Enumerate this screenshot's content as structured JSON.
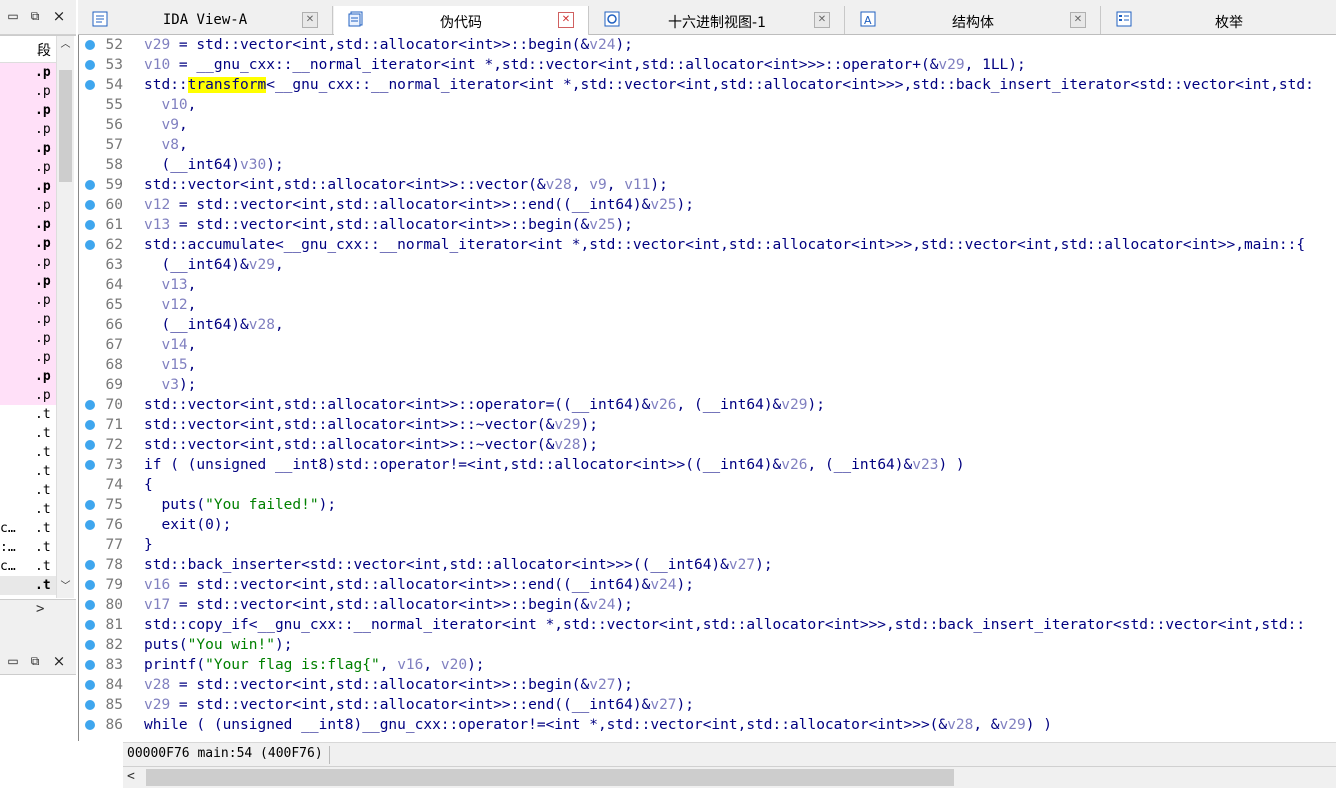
{
  "left_panel": {
    "title_buttons": [
      "×"
    ],
    "column_header": "段",
    "rows": [
      {
        "seg": ".p",
        "bold": true
      },
      {
        "seg": ".p",
        "bold": false
      },
      {
        "seg": ".p",
        "bold": true
      },
      {
        "seg": ".p",
        "bold": false
      },
      {
        "seg": ".p",
        "bold": true
      },
      {
        "seg": ".p",
        "bold": false
      },
      {
        "seg": ".p",
        "bold": true
      },
      {
        "seg": ".p",
        "bold": false
      },
      {
        "seg": ".p",
        "bold": true
      },
      {
        "seg": ".p",
        "bold": true
      },
      {
        "seg": ".p",
        "bold": false
      },
      {
        "seg": ".p",
        "bold": true
      },
      {
        "seg": ".p",
        "bold": false
      },
      {
        "seg": ".p",
        "bold": false
      },
      {
        "seg": ".p",
        "bold": false
      },
      {
        "seg": ".p",
        "bold": false
      },
      {
        "seg": ".p",
        "bold": true
      },
      {
        "seg": ".p",
        "bold": false
      },
      {
        "seg": ".t",
        "bold": false
      },
      {
        "seg": ".t",
        "bold": false
      },
      {
        "seg": ".t",
        "bold": false
      },
      {
        "seg": ".t",
        "bold": false
      },
      {
        "seg": ".t",
        "bold": false
      },
      {
        "seg": ".t",
        "bold": false
      },
      {
        "seg": ".t",
        "bold": false,
        "lbl": "c…"
      },
      {
        "seg": ".t",
        "bold": false,
        "lbl": ":…"
      },
      {
        "seg": ".t",
        "bold": false,
        "lbl": "c…"
      },
      {
        "seg": ".t",
        "bold": true
      }
    ],
    "hscroll_arrow": ">"
  },
  "tabs": [
    {
      "label": "IDA View-A",
      "icon": "ida-view-icon",
      "active": false
    },
    {
      "label": "伪代码",
      "icon": "pseudocode-icon",
      "active": true
    },
    {
      "label": "十六进制视图-1",
      "icon": "hex-view-icon",
      "active": false
    },
    {
      "label": "结构体",
      "icon": "structures-icon",
      "active": false
    },
    {
      "label": "枚举",
      "icon": "enums-icon",
      "active": false
    }
  ],
  "code_lines": [
    {
      "n": "52",
      "bp": true,
      "html": "<span class=\"v\">v29</span> = std::vector&lt;int,std::allocator&lt;int&gt;&gt;::begin(&amp;<span class=\"v\">v24</span>);"
    },
    {
      "n": "53",
      "bp": true,
      "html": "<span class=\"v\">v10</span> = __gnu_cxx::__normal_iterator&lt;int *,std::vector&lt;int,std::allocator&lt;int&gt;&gt;&gt;::operator+(&amp;<span class=\"v\">v29</span>, 1LL);"
    },
    {
      "n": "54",
      "bp": true,
      "html": "std::<span class=\"hl\">transform</span>&lt;__gnu_cxx::__normal_iterator&lt;int *,std::vector&lt;int,std::allocator&lt;int&gt;&gt;&gt;,std::back_insert_iterator&lt;std::vector&lt;int,std:"
    },
    {
      "n": "55",
      "bp": false,
      "html": "  <span class=\"v\">v10</span>,"
    },
    {
      "n": "56",
      "bp": false,
      "html": "  <span class=\"v\">v9</span>,"
    },
    {
      "n": "57",
      "bp": false,
      "html": "  <span class=\"v\">v8</span>,"
    },
    {
      "n": "58",
      "bp": false,
      "html": "  (__int64)<span class=\"v\">v30</span>);"
    },
    {
      "n": "59",
      "bp": true,
      "html": "std::vector&lt;int,std::allocator&lt;int&gt;&gt;::vector(&amp;<span class=\"v\">v28</span>, <span class=\"v\">v9</span>, <span class=\"v\">v11</span>);"
    },
    {
      "n": "60",
      "bp": true,
      "html": "<span class=\"v\">v12</span> = std::vector&lt;int,std::allocator&lt;int&gt;&gt;::end((__int64)&amp;<span class=\"v\">v25</span>);"
    },
    {
      "n": "61",
      "bp": true,
      "html": "<span class=\"v\">v13</span> = std::vector&lt;int,std::allocator&lt;int&gt;&gt;::begin(&amp;<span class=\"v\">v25</span>);"
    },
    {
      "n": "62",
      "bp": true,
      "html": "std::accumulate&lt;__gnu_cxx::__normal_iterator&lt;int *,std::vector&lt;int,std::allocator&lt;int&gt;&gt;&gt;,std::vector&lt;int,std::allocator&lt;int&gt;&gt;,main::{"
    },
    {
      "n": "63",
      "bp": false,
      "html": "  (__int64)&amp;<span class=\"v\">v29</span>,"
    },
    {
      "n": "64",
      "bp": false,
      "html": "  <span class=\"v\">v13</span>,"
    },
    {
      "n": "65",
      "bp": false,
      "html": "  <span class=\"v\">v12</span>,"
    },
    {
      "n": "66",
      "bp": false,
      "html": "  (__int64)&amp;<span class=\"v\">v28</span>,"
    },
    {
      "n": "67",
      "bp": false,
      "html": "  <span class=\"v\">v14</span>,"
    },
    {
      "n": "68",
      "bp": false,
      "html": "  <span class=\"v\">v15</span>,"
    },
    {
      "n": "69",
      "bp": false,
      "html": "  <span class=\"v\">v3</span>);"
    },
    {
      "n": "70",
      "bp": true,
      "html": "std::vector&lt;int,std::allocator&lt;int&gt;&gt;::operator=((__int64)&amp;<span class=\"v\">v26</span>, (__int64)&amp;<span class=\"v\">v29</span>);"
    },
    {
      "n": "71",
      "bp": true,
      "html": "std::vector&lt;int,std::allocator&lt;int&gt;&gt;::~vector(&amp;<span class=\"v\">v29</span>);"
    },
    {
      "n": "72",
      "bp": true,
      "html": "std::vector&lt;int,std::allocator&lt;int&gt;&gt;::~vector(&amp;<span class=\"v\">v28</span>);"
    },
    {
      "n": "73",
      "bp": true,
      "html": "if ( (unsigned __int8)std::operator!=&lt;int,std::allocator&lt;int&gt;&gt;((__int64)&amp;<span class=\"v\">v26</span>, (__int64)&amp;<span class=\"v\">v23</span>) )"
    },
    {
      "n": "74",
      "bp": false,
      "html": "{"
    },
    {
      "n": "75",
      "bp": true,
      "html": "  puts(<span class=\"s\">\"You failed!\"</span>);"
    },
    {
      "n": "76",
      "bp": true,
      "html": "  exit(0);"
    },
    {
      "n": "77",
      "bp": false,
      "html": "}"
    },
    {
      "n": "78",
      "bp": true,
      "html": "std::back_inserter&lt;std::vector&lt;int,std::allocator&lt;int&gt;&gt;&gt;((__int64)&amp;<span class=\"v\">v27</span>);"
    },
    {
      "n": "79",
      "bp": true,
      "html": "<span class=\"v\">v16</span> = std::vector&lt;int,std::allocator&lt;int&gt;&gt;::end((__int64)&amp;<span class=\"v\">v24</span>);"
    },
    {
      "n": "80",
      "bp": true,
      "html": "<span class=\"v\">v17</span> = std::vector&lt;int,std::allocator&lt;int&gt;&gt;::begin(&amp;<span class=\"v\">v24</span>);"
    },
    {
      "n": "81",
      "bp": true,
      "html": "std::copy_if&lt;__gnu_cxx::__normal_iterator&lt;int *,std::vector&lt;int,std::allocator&lt;int&gt;&gt;&gt;,std::back_insert_iterator&lt;std::vector&lt;int,std::"
    },
    {
      "n": "82",
      "bp": true,
      "html": "puts(<span class=\"s\">\"You win!\"</span>);"
    },
    {
      "n": "83",
      "bp": true,
      "html": "printf(<span class=\"s\">\"Your flag is:flag{\"</span>, <span class=\"v\">v16</span>, <span class=\"v\">v20</span>);"
    },
    {
      "n": "84",
      "bp": true,
      "html": "<span class=\"v\">v28</span> = std::vector&lt;int,std::allocator&lt;int&gt;&gt;::begin(&amp;<span class=\"v\">v27</span>);"
    },
    {
      "n": "85",
      "bp": true,
      "html": "<span class=\"v\">v29</span> = std::vector&lt;int,std::allocator&lt;int&gt;&gt;::end((__int64)&amp;<span class=\"v\">v27</span>);"
    },
    {
      "n": "86",
      "bp": true,
      "html": "while ( (unsigned __int8)__gnu_cxx::operator!=&lt;int *,std::vector&lt;int,std::allocator&lt;int&gt;&gt;&gt;(&amp;<span class=\"v\">v28</span>, &amp;<span class=\"v\">v29</span>) )"
    }
  ],
  "status": {
    "text": "00000F76 main:54 (400F76)"
  },
  "colors": {
    "breakpoint": "#3fa6ee",
    "variable": "#8080c0",
    "code": "#000080",
    "string": "#008000",
    "highlight": "#ffff00",
    "segment_pink": "#ffe0f8"
  }
}
